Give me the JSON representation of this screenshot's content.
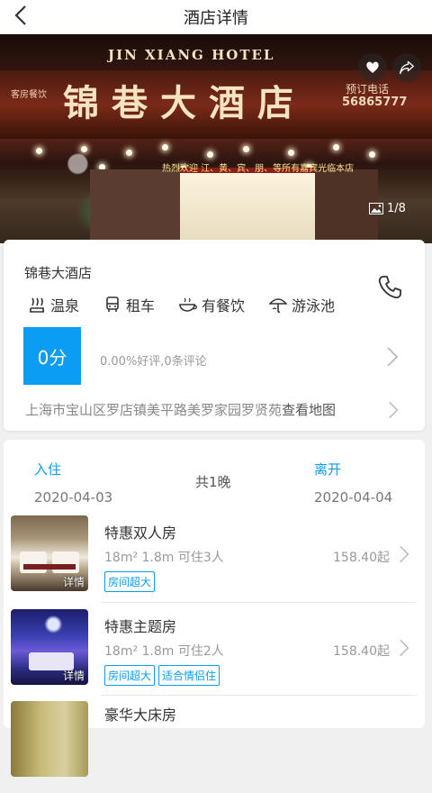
{
  "header": {
    "title": "酒店详情"
  },
  "hero": {
    "en_name": "JIN XIANG HOTEL",
    "cn_name": "锦巷大酒店",
    "left_tag": "客房餐饮",
    "phone_label": "预订电话",
    "phone_number": "56865777",
    "banner": "热烈欢迎 江、黄、宾、朋、等所有嘉宾光临本店",
    "photo_counter": "1/8"
  },
  "hotel": {
    "name": "锦巷大酒店",
    "amenities": [
      {
        "icon": "hot-spring-icon",
        "label": "温泉"
      },
      {
        "icon": "car-rental-icon",
        "label": "租车"
      },
      {
        "icon": "dining-icon",
        "label": "有餐饮"
      },
      {
        "icon": "pool-icon",
        "label": "游泳池"
      }
    ],
    "score": "0分",
    "rating_text": "0.00%好评,0条评论",
    "address": "上海市宝山区罗店镇美平路美罗家园罗贤苑",
    "map_link": "查看地图"
  },
  "booking": {
    "checkin_label": "入住",
    "checkin_date": "2020-04-03",
    "nights": "共1晚",
    "checkout_label": "离开",
    "checkout_date": "2020-04-04"
  },
  "rooms": [
    {
      "name": "特惠双人房",
      "spec": "18m² 1.8m 可住3人",
      "price": "158.40起",
      "tags": [
        "房间超大"
      ],
      "detail": "详情"
    },
    {
      "name": "特惠主题房",
      "spec": "18m² 1.8m 可住2人",
      "price": "158.40起",
      "tags": [
        "房间超大",
        "适合情侣住"
      ],
      "detail": "详情"
    },
    {
      "name": "豪华大床房"
    }
  ],
  "colors": {
    "accent": "#0a9df2"
  }
}
